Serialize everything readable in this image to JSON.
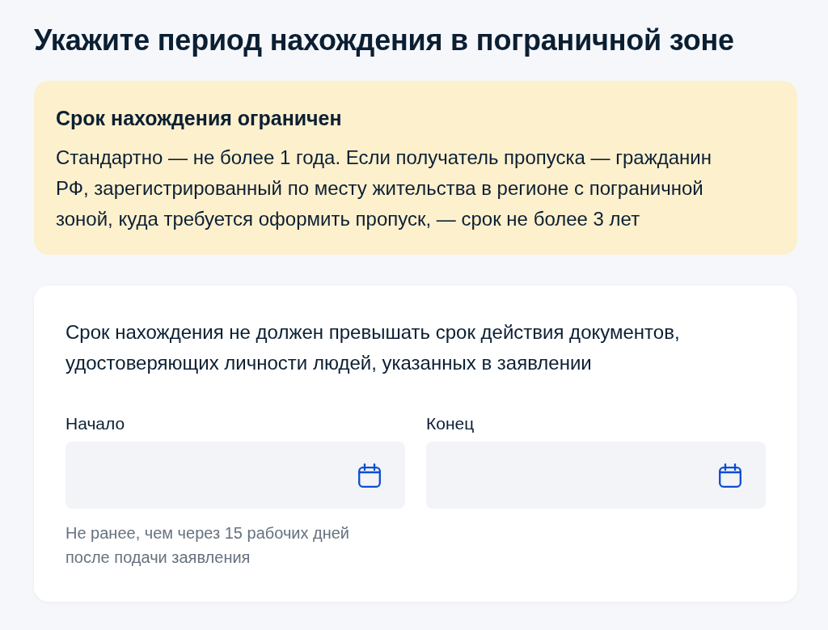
{
  "page": {
    "title": "Укажите период нахождения в пограничной зоне"
  },
  "notice": {
    "title": "Срок нахождения ограничен",
    "text": "Стандартно — не более 1 года. Если получатель пропуска — гражданин РФ, зарегистрированный по месту жительства в регионе с пограничной зоной, куда требуется оформить пропуск, — срок не более 3 лет"
  },
  "form": {
    "description": "Срок нахождения не должен превышать срок действия документов, удостоверяющих личности людей, указанных в заявлении",
    "fields": [
      {
        "label": "Начало",
        "hint": "Не ранее, чем через 15 рабочих дней после подачи заявления"
      },
      {
        "label": "Конец"
      }
    ]
  }
}
